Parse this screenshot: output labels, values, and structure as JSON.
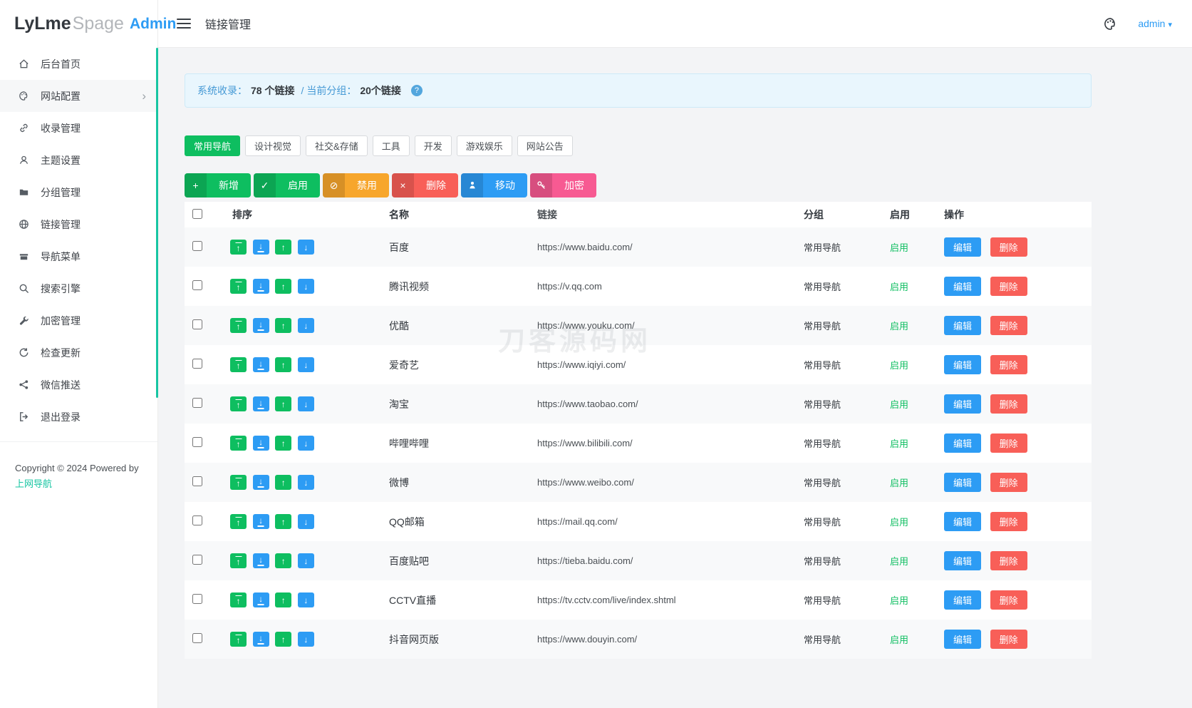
{
  "brand": {
    "part1": "LyLme",
    "part2": "Spage",
    "part3": "Admin"
  },
  "topbar": {
    "title": "链接管理",
    "user": "admin"
  },
  "icons": {
    "caret_down": "▾",
    "chevron_right": "›",
    "plus": "+",
    "check": "✓",
    "ban": "⊘",
    "close": "×",
    "up": "↑",
    "down": "↓",
    "question": "?"
  },
  "colors": {
    "green": "#0ebe60",
    "blue": "#2d9cf4",
    "orange": "#f7a62c",
    "red": "#f85f58",
    "pink": "#f75a92",
    "teal": "#17c5a2"
  },
  "sidebar": {
    "items": [
      {
        "label": "后台首页"
      },
      {
        "label": "网站配置"
      },
      {
        "label": "收录管理"
      },
      {
        "label": "主题设置"
      },
      {
        "label": "分组管理"
      },
      {
        "label": "链接管理"
      },
      {
        "label": "导航菜单"
      },
      {
        "label": "搜索引擎"
      },
      {
        "label": "加密管理"
      },
      {
        "label": "检查更新"
      },
      {
        "label": "微信推送"
      },
      {
        "label": "退出登录"
      }
    ],
    "copyright": "Copyright © 2024 Powered by",
    "copyright_link": "上网导航"
  },
  "alert": {
    "label_total": "系统收录：",
    "value_total": "78 个链接",
    "separator": "/",
    "label_group": "当前分组：",
    "value_group": "20个链接"
  },
  "tabs": [
    {
      "label": "常用导航"
    },
    {
      "label": "设计视觉"
    },
    {
      "label": "社交&存储"
    },
    {
      "label": "工具"
    },
    {
      "label": "开发"
    },
    {
      "label": "游戏娱乐"
    },
    {
      "label": "网站公告"
    }
  ],
  "toolbar": {
    "add": "新增",
    "enable": "启用",
    "disable": "禁用",
    "delete": "删除",
    "move": "移动",
    "encrypt": "加密"
  },
  "table": {
    "headers": {
      "sort": "排序",
      "name": "名称",
      "link": "链接",
      "group": "分组",
      "enabled": "启用",
      "actions": "操作"
    },
    "edit": "编辑",
    "delete": "删除",
    "rows": [
      {
        "name": "百度",
        "url": "https://www.baidu.com/",
        "group": "常用导航",
        "status": "启用"
      },
      {
        "name": "腾讯视频",
        "url": "https://v.qq.com",
        "group": "常用导航",
        "status": "启用"
      },
      {
        "name": "优酷",
        "url": "https://www.youku.com/",
        "group": "常用导航",
        "status": "启用"
      },
      {
        "name": "爱奇艺",
        "url": "https://www.iqiyi.com/",
        "group": "常用导航",
        "status": "启用"
      },
      {
        "name": "淘宝",
        "url": "https://www.taobao.com/",
        "group": "常用导航",
        "status": "启用"
      },
      {
        "name": "哔哩哔哩",
        "url": "https://www.bilibili.com/",
        "group": "常用导航",
        "status": "启用"
      },
      {
        "name": "微博",
        "url": "https://www.weibo.com/",
        "group": "常用导航",
        "status": "启用"
      },
      {
        "name": "QQ邮箱",
        "url": "https://mail.qq.com/",
        "group": "常用导航",
        "status": "启用"
      },
      {
        "name": "百度贴吧",
        "url": "https://tieba.baidu.com/",
        "group": "常用导航",
        "status": "启用"
      },
      {
        "name": "CCTV直播",
        "url": "https://tv.cctv.com/live/index.shtml",
        "group": "常用导航",
        "status": "启用"
      },
      {
        "name": "抖音网页版",
        "url": "https://www.douyin.com/",
        "group": "常用导航",
        "status": "启用"
      }
    ]
  },
  "watermark": {
    "text": "刀客源码网"
  }
}
